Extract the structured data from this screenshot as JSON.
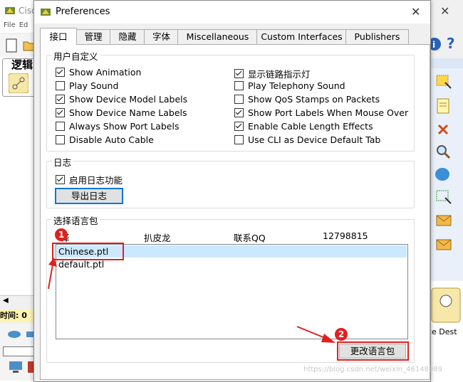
{
  "background": {
    "app_title": "Cisc",
    "menu": [
      "File",
      "Ed"
    ],
    "logical_tab": "逻辑",
    "time_label": "时间: 0",
    "pdu_text": "ce  Dest"
  },
  "dialog": {
    "title": "Preferences",
    "close_glyph": "✕"
  },
  "tabs": [
    {
      "label": "接口",
      "active": true
    },
    {
      "label": "管理"
    },
    {
      "label": "隐藏"
    },
    {
      "label": "字体"
    },
    {
      "label": "Miscellaneous"
    },
    {
      "label": "Custom Interfaces"
    },
    {
      "label": "Publishers"
    }
  ],
  "user_custom": {
    "legend": "用户自定义",
    "left": [
      {
        "label": "Show Animation",
        "checked": true
      },
      {
        "label": "Play Sound",
        "checked": false
      },
      {
        "label": "Show Device Model Labels",
        "checked": true
      },
      {
        "label": "Show Device Name Labels",
        "checked": true
      },
      {
        "label": "Always Show Port Labels",
        "checked": false
      },
      {
        "label": "Disable Auto Cable",
        "checked": false
      }
    ],
    "right": [
      {
        "label": "显示链路指示灯",
        "checked": true
      },
      {
        "label": "Play Telephony Sound",
        "checked": false
      },
      {
        "label": "Show QoS Stamps on Packets",
        "checked": false
      },
      {
        "label": "Show Port Labels When Mouse Over",
        "checked": true
      },
      {
        "label": "Enable Cable Length Effects",
        "checked": true
      },
      {
        "label": "Use CLI as Device Default Tab",
        "checked": false
      }
    ]
  },
  "log": {
    "legend": "日志",
    "enable_label": "启用日志功能",
    "enable_checked": true,
    "export_button": "导出日志"
  },
  "language": {
    "legend": "选择语言包",
    "header": [
      "译",
      "扒皮龙",
      "联系QQ",
      "12798815"
    ],
    "items": [
      "Chinese.ptl",
      "default.ptl"
    ],
    "change_button": "更改语言包"
  },
  "annotations": {
    "badge1": "1",
    "badge2": "2"
  },
  "watermark": "https://blog.csdn.net/weixin_46148989",
  "colors": {
    "accent": "#0078d7",
    "annotation": "#e02020",
    "selection": "#cce8ff"
  }
}
